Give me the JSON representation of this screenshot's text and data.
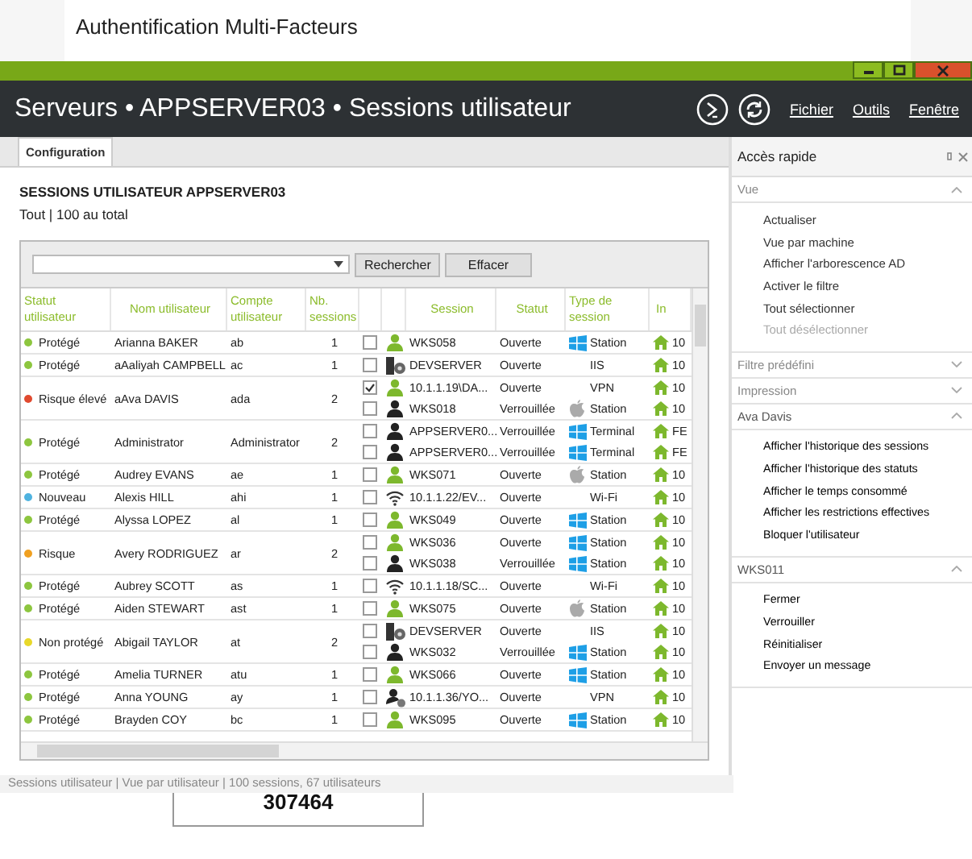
{
  "backdrop": {
    "heading": "Authentification Multi-Facteurs",
    "code": "307464"
  },
  "window": {
    "title": "Serveurs • APPSERVER03 • Sessions utilisateur",
    "menus": [
      "Fichier",
      "Outils",
      "Fenêtre"
    ]
  },
  "tabs": [
    {
      "label": "Configuration",
      "selected": true
    }
  ],
  "page": {
    "heading": "SESSIONS UTILISATEUR APPSERVER03",
    "subheading": "Tout | 100 au total"
  },
  "search": {
    "buttons": [
      "Rechercher",
      "Effacer"
    ]
  },
  "table": {
    "columns": [
      "Statut utilisateur",
      "Nom utilisateur",
      "Compte utilisateur",
      "Nb. sessions",
      "",
      "",
      "Session",
      "Statut",
      "Type de session",
      "In"
    ],
    "rows": [
      {
        "status": "Protégé",
        "color": "#8dc63f",
        "name": "Arianna BAKER",
        "account": "ab",
        "count": "1",
        "sessions": [
          {
            "checked": false,
            "kind": "user-open",
            "session": "WKS058",
            "state": "Ouverte",
            "type": {
              "kind": "windows",
              "label": "Station"
            },
            "ip": "10"
          }
        ]
      },
      {
        "status": "Protégé",
        "color": "#8dc63f",
        "name": "aAaliyah CAMPBELL",
        "account": "ac",
        "count": "1",
        "sessions": [
          {
            "checked": false,
            "kind": "server",
            "session": "DEVSERVER",
            "state": "Ouverte",
            "type": {
              "kind": "none",
              "label": "IIS"
            },
            "ip": "10"
          }
        ]
      },
      {
        "status": "Risque élevé",
        "color": "#e04a2f",
        "name": "aAva DAVIS",
        "account": "ada",
        "count": "2",
        "sessions": [
          {
            "checked": true,
            "kind": "user-open",
            "session": "10.1.1.19\\DA...",
            "state": "Ouverte",
            "type": {
              "kind": "none",
              "label": "VPN"
            },
            "ip": "10"
          },
          {
            "checked": false,
            "kind": "user-locked",
            "session": "WKS018",
            "state": "Verrouillée",
            "type": {
              "kind": "apple",
              "label": "Station"
            },
            "ip": "10"
          }
        ]
      },
      {
        "status": "Protégé",
        "color": "#8dc63f",
        "name": "Administrator",
        "account": "Administrator",
        "count": "2",
        "sessions": [
          {
            "checked": false,
            "kind": "user-locked",
            "session": "APPSERVER0...",
            "state": "Verrouillée",
            "type": {
              "kind": "windows",
              "label": "Terminal"
            },
            "ip": "FE"
          },
          {
            "checked": false,
            "kind": "user-locked",
            "session": "APPSERVER0...",
            "state": "Verrouillée",
            "type": {
              "kind": "windows",
              "label": "Terminal"
            },
            "ip": "FE"
          }
        ]
      },
      {
        "status": "Protégé",
        "color": "#8dc63f",
        "name": "Audrey EVANS",
        "account": "ae",
        "count": "1",
        "sessions": [
          {
            "checked": false,
            "kind": "user-open",
            "session": "WKS071",
            "state": "Ouverte",
            "type": {
              "kind": "apple",
              "label": "Station"
            },
            "ip": "10"
          }
        ]
      },
      {
        "status": "Nouveau",
        "color": "#4fb3e0",
        "name": "Alexis HILL",
        "account": "ahi",
        "count": "1",
        "sessions": [
          {
            "checked": false,
            "kind": "wifi",
            "session": "10.1.1.22/EV...",
            "state": "Ouverte",
            "type": {
              "kind": "none",
              "label": "Wi-Fi"
            },
            "ip": "10"
          }
        ]
      },
      {
        "status": "Protégé",
        "color": "#8dc63f",
        "name": "Alyssa LOPEZ",
        "account": "al",
        "count": "1",
        "sessions": [
          {
            "checked": false,
            "kind": "user-open",
            "session": "WKS049",
            "state": "Ouverte",
            "type": {
              "kind": "windows",
              "label": "Station"
            },
            "ip": "10"
          }
        ]
      },
      {
        "status": "Risque",
        "color": "#f0a020",
        "name": "Avery RODRIGUEZ",
        "account": "ar",
        "count": "2",
        "sessions": [
          {
            "checked": false,
            "kind": "user-open",
            "session": "WKS036",
            "state": "Ouverte",
            "type": {
              "kind": "windows",
              "label": "Station"
            },
            "ip": "10"
          },
          {
            "checked": false,
            "kind": "user-locked",
            "session": "WKS038",
            "state": "Verrouillée",
            "type": {
              "kind": "windows",
              "label": "Station"
            },
            "ip": "10"
          }
        ]
      },
      {
        "status": "Protégé",
        "color": "#8dc63f",
        "name": "Aubrey SCOTT",
        "account": "as",
        "count": "1",
        "sessions": [
          {
            "checked": false,
            "kind": "wifi",
            "session": "10.1.1.18/SC...",
            "state": "Ouverte",
            "type": {
              "kind": "none",
              "label": "Wi-Fi"
            },
            "ip": "10"
          }
        ]
      },
      {
        "status": "Protégé",
        "color": "#8dc63f",
        "name": "Aiden STEWART",
        "account": "ast",
        "count": "1",
        "sessions": [
          {
            "checked": false,
            "kind": "user-open",
            "session": "WKS075",
            "state": "Ouverte",
            "type": {
              "kind": "apple",
              "label": "Station"
            },
            "ip": "10"
          }
        ]
      },
      {
        "status": "Non protégé",
        "color": "#e8d82a",
        "name": "Abigail TAYLOR",
        "account": "at",
        "count": "2",
        "sessions": [
          {
            "checked": false,
            "kind": "server",
            "session": "DEVSERVER",
            "state": "Ouverte",
            "type": {
              "kind": "none",
              "label": "IIS"
            },
            "ip": "10"
          },
          {
            "checked": false,
            "kind": "user-locked",
            "session": "WKS032",
            "state": "Verrouillée",
            "type": {
              "kind": "windows",
              "label": "Station"
            },
            "ip": "10"
          }
        ]
      },
      {
        "status": "Protégé",
        "color": "#8dc63f",
        "name": "Amelia TURNER",
        "account": "atu",
        "count": "1",
        "sessions": [
          {
            "checked": false,
            "kind": "user-open",
            "session": "WKS066",
            "state": "Ouverte",
            "type": {
              "kind": "windows",
              "label": "Station"
            },
            "ip": "10"
          }
        ]
      },
      {
        "status": "Protégé",
        "color": "#8dc63f",
        "name": "Anna YOUNG",
        "account": "ay",
        "count": "1",
        "sessions": [
          {
            "checked": false,
            "kind": "user-remote",
            "session": "10.1.1.36/YO...",
            "state": "Ouverte",
            "type": {
              "kind": "none",
              "label": "VPN"
            },
            "ip": "10"
          }
        ]
      },
      {
        "status": "Protégé",
        "color": "#8dc63f",
        "name": "Brayden COY",
        "account": "bc",
        "count": "1",
        "sessions": [
          {
            "checked": false,
            "kind": "user-open",
            "session": "WKS095",
            "state": "Ouverte",
            "type": {
              "kind": "windows",
              "label": "Station"
            },
            "ip": "10"
          }
        ]
      }
    ]
  },
  "status_bar": "Sessions utilisateur | Vue par utilisateur | 100 sessions, 67 utilisateurs",
  "quick_access": {
    "title": "Accès rapide",
    "sections": [
      {
        "title": "Vue",
        "expanded": true,
        "emphasis": false,
        "items": [
          {
            "label": "Actualiser",
            "disabled": false
          },
          {
            "label": "Vue par machine",
            "disabled": false
          },
          {
            "label": "Afficher l'arborescence AD",
            "disabled": false
          },
          {
            "label": "Activer le filtre",
            "disabled": false
          },
          {
            "label": "Tout sélectionner",
            "disabled": false
          },
          {
            "label": "Tout désélectionner",
            "disabled": true
          }
        ]
      },
      {
        "title": "Filtre prédéfini",
        "expanded": false,
        "emphasis": false
      },
      {
        "title": "Impression",
        "expanded": false,
        "emphasis": false
      },
      {
        "title": "Ava Davis",
        "expanded": true,
        "emphasis": true,
        "items": [
          {
            "label": "Afficher l'historique des sessions",
            "disabled": false
          },
          {
            "label": "Afficher l'historique des statuts",
            "disabled": false
          },
          {
            "label": "Afficher le temps consommé",
            "disabled": false
          },
          {
            "label": "Afficher les restrictions effectives",
            "disabled": false
          },
          {
            "label": "Bloquer l'utilisateur",
            "disabled": false
          }
        ]
      },
      {
        "title": "WKS011",
        "expanded": true,
        "emphasis": true,
        "items": [
          {
            "label": "Fermer",
            "disabled": false
          },
          {
            "label": "Verrouiller",
            "disabled": false
          },
          {
            "label": "Réinitialiser",
            "disabled": false
          },
          {
            "label": "Envoyer un message",
            "disabled": false
          }
        ]
      }
    ]
  }
}
